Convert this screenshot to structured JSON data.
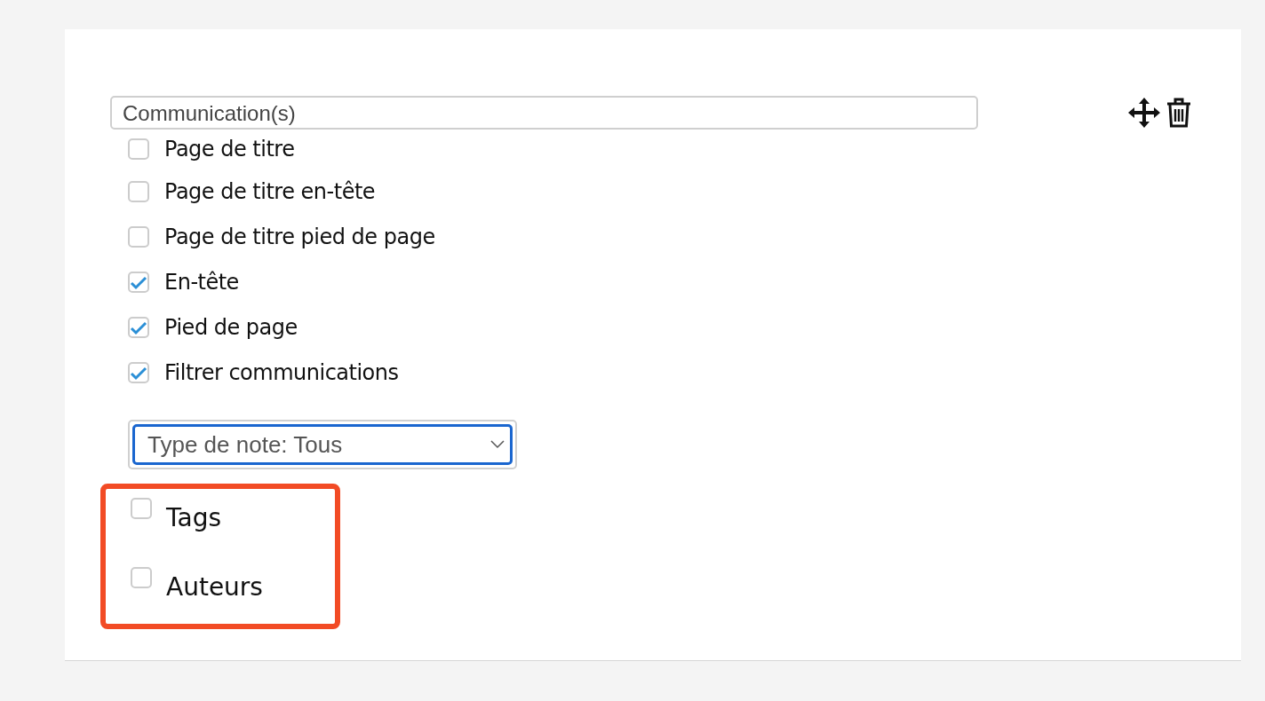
{
  "section": {
    "title": "Communication(s)"
  },
  "options": [
    {
      "label": "Page de titre",
      "checked": false
    },
    {
      "label": "Page de titre en-tête",
      "checked": false
    },
    {
      "label": "Page de titre pied de page",
      "checked": false
    },
    {
      "label": "En-tête",
      "checked": true
    },
    {
      "label": "Pied de page",
      "checked": true
    },
    {
      "label": "Filtrer communications",
      "checked": true
    }
  ],
  "note_type_select": {
    "value": "Type de note: Tous"
  },
  "highlighted_options": [
    {
      "label": "Tags",
      "checked": false
    },
    {
      "label": "Auteurs",
      "checked": false
    }
  ]
}
